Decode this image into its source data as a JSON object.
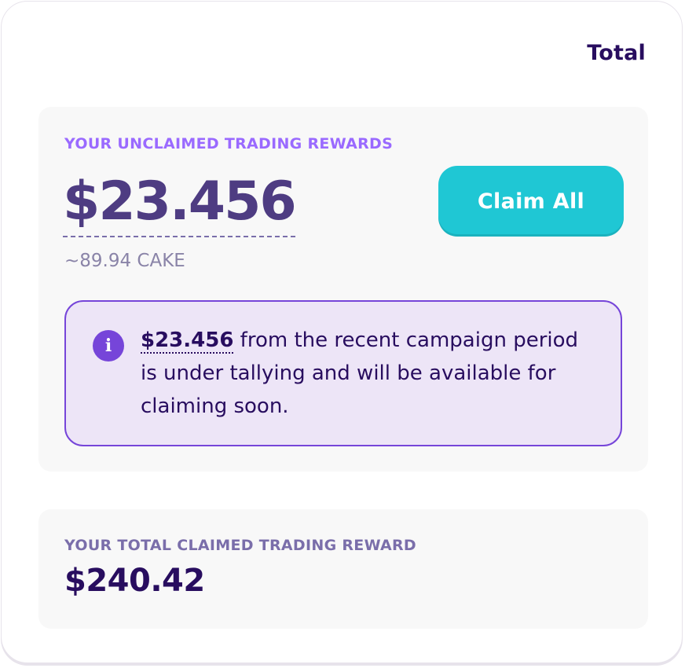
{
  "header": {
    "total_label": "Total"
  },
  "unclaimed": {
    "label": "YOUR  UNCLAIMED TRADING REWARDS",
    "amount": "$23.456",
    "cake_equivalent": "~89.94 CAKE",
    "claim_button_label": "Claim All",
    "info": {
      "icon": "info-icon",
      "icon_glyph": "i",
      "amount": "$23.456",
      "message": " from the recent campaign period is under tallying and will be available for claiming soon."
    }
  },
  "claimed": {
    "label": "YOUR  TOTAL CLAIMED TRADING REWARD",
    "amount": "$240.42"
  },
  "colors": {
    "accent_purple": "#7645d9",
    "label_purple": "#9a6aff",
    "primary_cyan": "#1fc7d4",
    "text_dark": "#280d5f",
    "panel_bg": "#f8f8f8",
    "info_bg": "#ede5f7"
  }
}
